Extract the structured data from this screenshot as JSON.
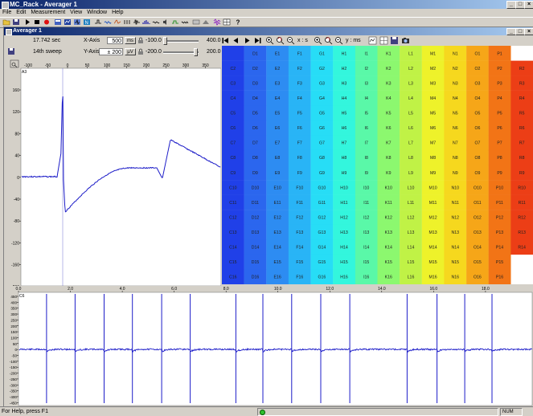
{
  "app": {
    "title": "MC_Rack - Averager 1",
    "controls": {
      "min": "_",
      "max": "□",
      "close": "×"
    }
  },
  "menu": [
    "File",
    "Edit",
    "Measurement",
    "View",
    "Window",
    "Help"
  ],
  "child_window": {
    "title": "Averager 1",
    "controls": {
      "min": "_",
      "max": "□",
      "close": "×"
    }
  },
  "controls": {
    "time": "17.742 sec",
    "sweep": "14th sweep",
    "xaxis_label": "X-Axis",
    "xaxis_value": "500",
    "xaxis_unit": "ms",
    "xaxis_min": "-100.0",
    "xaxis_max": "400.0",
    "yaxis_label": "Y-Axis",
    "yaxis_value": "± 200",
    "yaxis_unit": "µV",
    "yaxis_min": "-200.0",
    "yaxis_max": "200.0"
  },
  "navbar": {
    "x_label": "x : s",
    "y_label": "y : ms"
  },
  "grid_cells": {
    "columns": [
      "C",
      "D",
      "E",
      "F",
      "G",
      "H",
      "I",
      "K",
      "L",
      "M",
      "N",
      "O",
      "P",
      "R"
    ],
    "rows": [
      "1",
      "2",
      "3",
      "4",
      "5",
      "6",
      "7",
      "8",
      "9",
      "10",
      "11",
      "12",
      "13",
      "14",
      "15",
      "16"
    ],
    "colors": [
      "#2040e8",
      "#2b66ee",
      "#2d8cf2",
      "#29b4f6",
      "#27ddf6",
      "#33f6dd",
      "#5af8a8",
      "#8cf86f",
      "#c0f246",
      "#eef22a",
      "#f6d81e",
      "#f6a618",
      "#f27416",
      "#ec3e16"
    ]
  },
  "plotA": {
    "channel": "A3",
    "x_ticks": [
      "-100",
      "-50",
      "0",
      "50",
      "100",
      "150",
      "200",
      "250",
      "300",
      "350"
    ],
    "y_ticks": [
      "160",
      "120",
      "80",
      "40",
      "0",
      "-40",
      "-80",
      "-120",
      "-160",
      "-200"
    ],
    "trace_color": "#1c1cc8"
  },
  "plotB": {
    "channel": "C6",
    "x_ticks": [
      "0.0",
      "2.0",
      "4.0",
      "6.0",
      "8.0",
      "10.0",
      "12.0",
      "14.0",
      "16.0",
      "18.0"
    ],
    "y_ticks": [
      "450",
      "400",
      "350",
      "300",
      "250",
      "200",
      "150",
      "100",
      "50",
      "0",
      "-50",
      "-100",
      "-150",
      "-200",
      "-250",
      "-300",
      "-350",
      "-400",
      "-450"
    ],
    "spike_times": [
      1.08,
      2.18,
      3.3,
      4.39,
      5.52,
      6.62,
      8.38,
      9.42,
      10.53,
      11.65,
      12.77,
      14.98,
      16.13,
      17.2,
      18.25
    ],
    "x_max": 19.8,
    "trace_color": "#1c1cc8"
  },
  "status": {
    "help": "For Help, press F1",
    "num": "NUM"
  }
}
